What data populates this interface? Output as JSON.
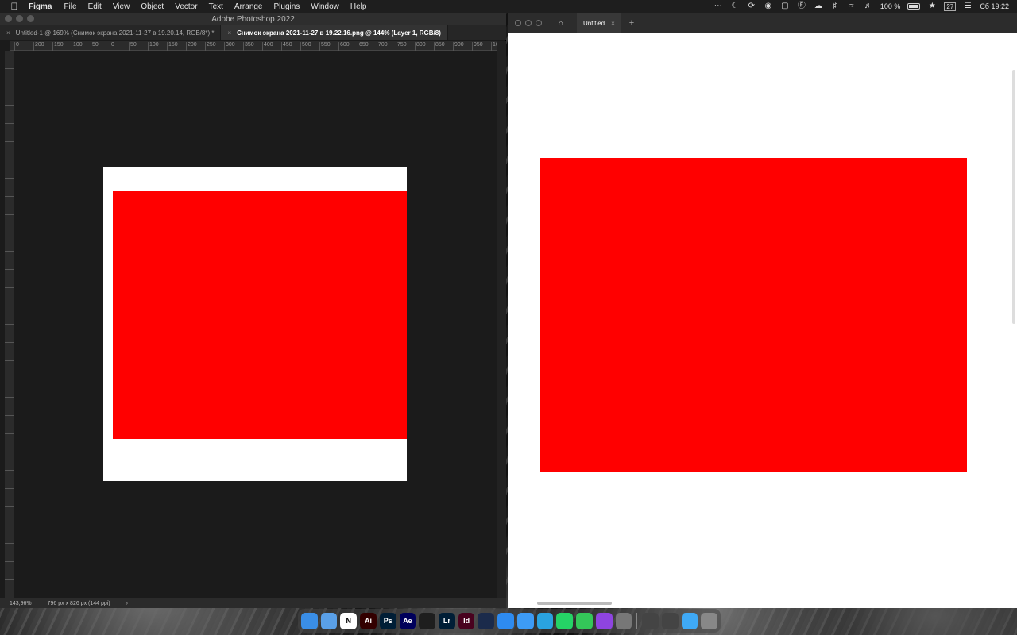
{
  "menubar": {
    "app_name": "Figma",
    "items": [
      "File",
      "Edit",
      "View",
      "Object",
      "Vector",
      "Text",
      "Arrange",
      "Plugins",
      "Window",
      "Help"
    ],
    "battery": "100 %",
    "clock": "Сб 19:22",
    "calendar_day": "27"
  },
  "photoshop": {
    "title": "Adobe Photoshop 2022",
    "tabs": [
      {
        "label": "Untitled-1 @ 169% (Снимок экрана 2021-11-27 в 19.20.14, RGB/8*) *",
        "active": false
      },
      {
        "label": "Снимок экрана 2021-11-27 в 19.22.16.png @ 144% (Layer 1, RGB/8)",
        "active": true
      }
    ],
    "ruler_ticks": [
      "0",
      "200",
      "150",
      "100",
      "50",
      "0",
      "50",
      "100",
      "150",
      "200",
      "250",
      "300",
      "350",
      "400",
      "450",
      "500",
      "550",
      "600",
      "650",
      "700",
      "750",
      "800",
      "850",
      "900",
      "950",
      "100"
    ],
    "status": {
      "zoom": "143,96%",
      "doc_size": "796 px x 826 px (144 ppi)"
    }
  },
  "figma": {
    "tab_label": "Untitled"
  },
  "colors": {
    "shape_fill": "#ff0000",
    "ps_bg": "#1b1b1b"
  },
  "dock": {
    "apps": [
      {
        "name": "finder-icon",
        "label": "",
        "bg": "#3a8ee6"
      },
      {
        "name": "cloud-app-icon",
        "label": "",
        "bg": "#5aa0e8"
      },
      {
        "name": "notion-icon",
        "label": "N",
        "bg": "#ffffff"
      },
      {
        "name": "illustrator-icon",
        "label": "Ai",
        "bg": "#330000"
      },
      {
        "name": "photoshop-icon",
        "label": "Ps",
        "bg": "#001e36"
      },
      {
        "name": "after-effects-icon",
        "label": "Ae",
        "bg": "#00005b"
      },
      {
        "name": "figma-icon",
        "label": "",
        "bg": "#1e1e1e"
      },
      {
        "name": "lightroom-icon",
        "label": "Lr",
        "bg": "#001e36"
      },
      {
        "name": "indesign-icon",
        "label": "Id",
        "bg": "#49021f"
      },
      {
        "name": "cinema4d-icon",
        "label": "",
        "bg": "#1b2b4b"
      },
      {
        "name": "mail-icon",
        "label": "",
        "bg": "#2e8bf0"
      },
      {
        "name": "safari-icon",
        "label": "",
        "bg": "#3d9bf5"
      },
      {
        "name": "telegram-icon",
        "label": "",
        "bg": "#2aa3e0"
      },
      {
        "name": "whatsapp-icon",
        "label": "",
        "bg": "#25d366"
      },
      {
        "name": "messages-icon",
        "label": "",
        "bg": "#34c759"
      },
      {
        "name": "podcasts-icon",
        "label": "",
        "bg": "#8e44e0"
      },
      {
        "name": "system-preferences-icon",
        "label": "",
        "bg": "#777777"
      },
      {
        "name": "downloads-icon",
        "label": "",
        "bg": "#444444"
      },
      {
        "name": "screenshot-icon",
        "label": "",
        "bg": "#444444"
      },
      {
        "name": "folder-icon",
        "label": "",
        "bg": "#3fa9f5"
      },
      {
        "name": "trash-icon",
        "label": "",
        "bg": "#888888"
      }
    ]
  }
}
